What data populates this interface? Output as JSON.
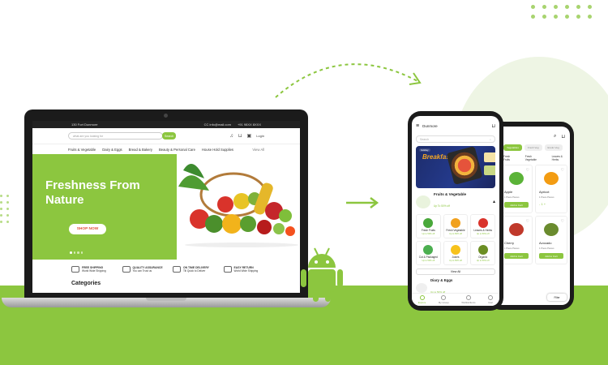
{
  "colors": {
    "accent": "#8cc63f",
    "shop_button_text": "#e0503a",
    "device": "#1b1b1b"
  },
  "website": {
    "topbar": {
      "location": "130 Fort Dunmore",
      "email": "CC info@mail.com",
      "phone": "+91 98XX 8XXX"
    },
    "search": {
      "placeholder": "what are you looking for",
      "button": "Search"
    },
    "header_icons": {
      "notification": "bell-icon",
      "cart": "cart-icon",
      "login_label": "Login"
    },
    "categories_nav": [
      "Fruits & Vegetable",
      "Dairy & Eggs",
      "Bread & Bakery",
      "Beauty & Personal Care",
      "House Hold Supplies"
    ],
    "view_all": "View All",
    "hero": {
      "title": "Freshness From Nature",
      "button": "SHOP NOW"
    },
    "features": [
      {
        "title": "FREE SHIPPING",
        "sub": "World Wide Shipping"
      },
      {
        "title": "QUALITY ASSURANCE",
        "sub": "You can Trust us"
      },
      {
        "title": "ON TIME DELIVERY",
        "sub": "Till Quick to Deliver"
      },
      {
        "title": "EASY RETURN",
        "sub": "World Wide Shipping"
      }
    ],
    "categories_heading": "Categories"
  },
  "phone1": {
    "location": "Dunmore",
    "search_placeholder": "Search",
    "banner": {
      "brand": "holiday",
      "title": "Breakfast Time"
    },
    "section": {
      "title": "Fruits & Vegetable",
      "sub": "Up To 50% off"
    },
    "products": [
      {
        "name": "Fresh Fruits",
        "price": "Up to 50% off",
        "color": "#49a83a"
      },
      {
        "name": "Fresh Vegetable",
        "price": "Up to 50% off",
        "color": "#f1a11e"
      },
      {
        "name": "Leaves & Herbs",
        "price": "Up to 50% off",
        "color": "#d9332b"
      },
      {
        "name": "Cut & Packaged",
        "price": "Up to 50% off",
        "color": "#4caf50"
      },
      {
        "name": "Juices",
        "price": "Up to 50% off",
        "color": "#f7c21b"
      },
      {
        "name": "Organic",
        "price": "Up to 50% off",
        "color": "#6b8e23"
      }
    ],
    "view_all": "View All",
    "dairy": {
      "title": "Diary & Eggs",
      "sub": "Up to 50% off"
    },
    "tabs": [
      "Explore",
      "My Lineup",
      "Wishlist/Items",
      "User"
    ]
  },
  "phone2": {
    "chips": [
      "Vegetables",
      "Fresh Veg",
      "Exotic Veg"
    ],
    "subcats": [
      "Fresh Fruits",
      "Fresh Vegetable",
      "Leaves & Herbs"
    ],
    "products": [
      {
        "name": "Apple",
        "price": "",
        "pieces": "1 Piece Pieces",
        "action": "Add to Cart",
        "color": "#5bb338"
      },
      {
        "name": "Apricot",
        "price": "QAR 30",
        "pieces": "1 Piece Pieces",
        "action": "",
        "color": "#f39c12"
      },
      {
        "name": "Cherry",
        "price": "",
        "pieces": "1 Piece Pieces",
        "action": "Add to Cart",
        "color": "#c0392b"
      },
      {
        "name": "Avocado",
        "price": "QAR 30",
        "pieces": "1 Piece Pieces",
        "action": "Add to Cart",
        "color": "#6a8b2e"
      },
      {
        "name": "",
        "price": "QAR 30",
        "pieces": "",
        "action": "",
        "color": "#d9332b"
      },
      {
        "name": "",
        "price": "",
        "pieces": "",
        "action": "",
        "color": "#f0b429"
      }
    ],
    "steppers": [
      "- 1 +",
      "- 1 +"
    ],
    "filter_label": "Filter"
  }
}
